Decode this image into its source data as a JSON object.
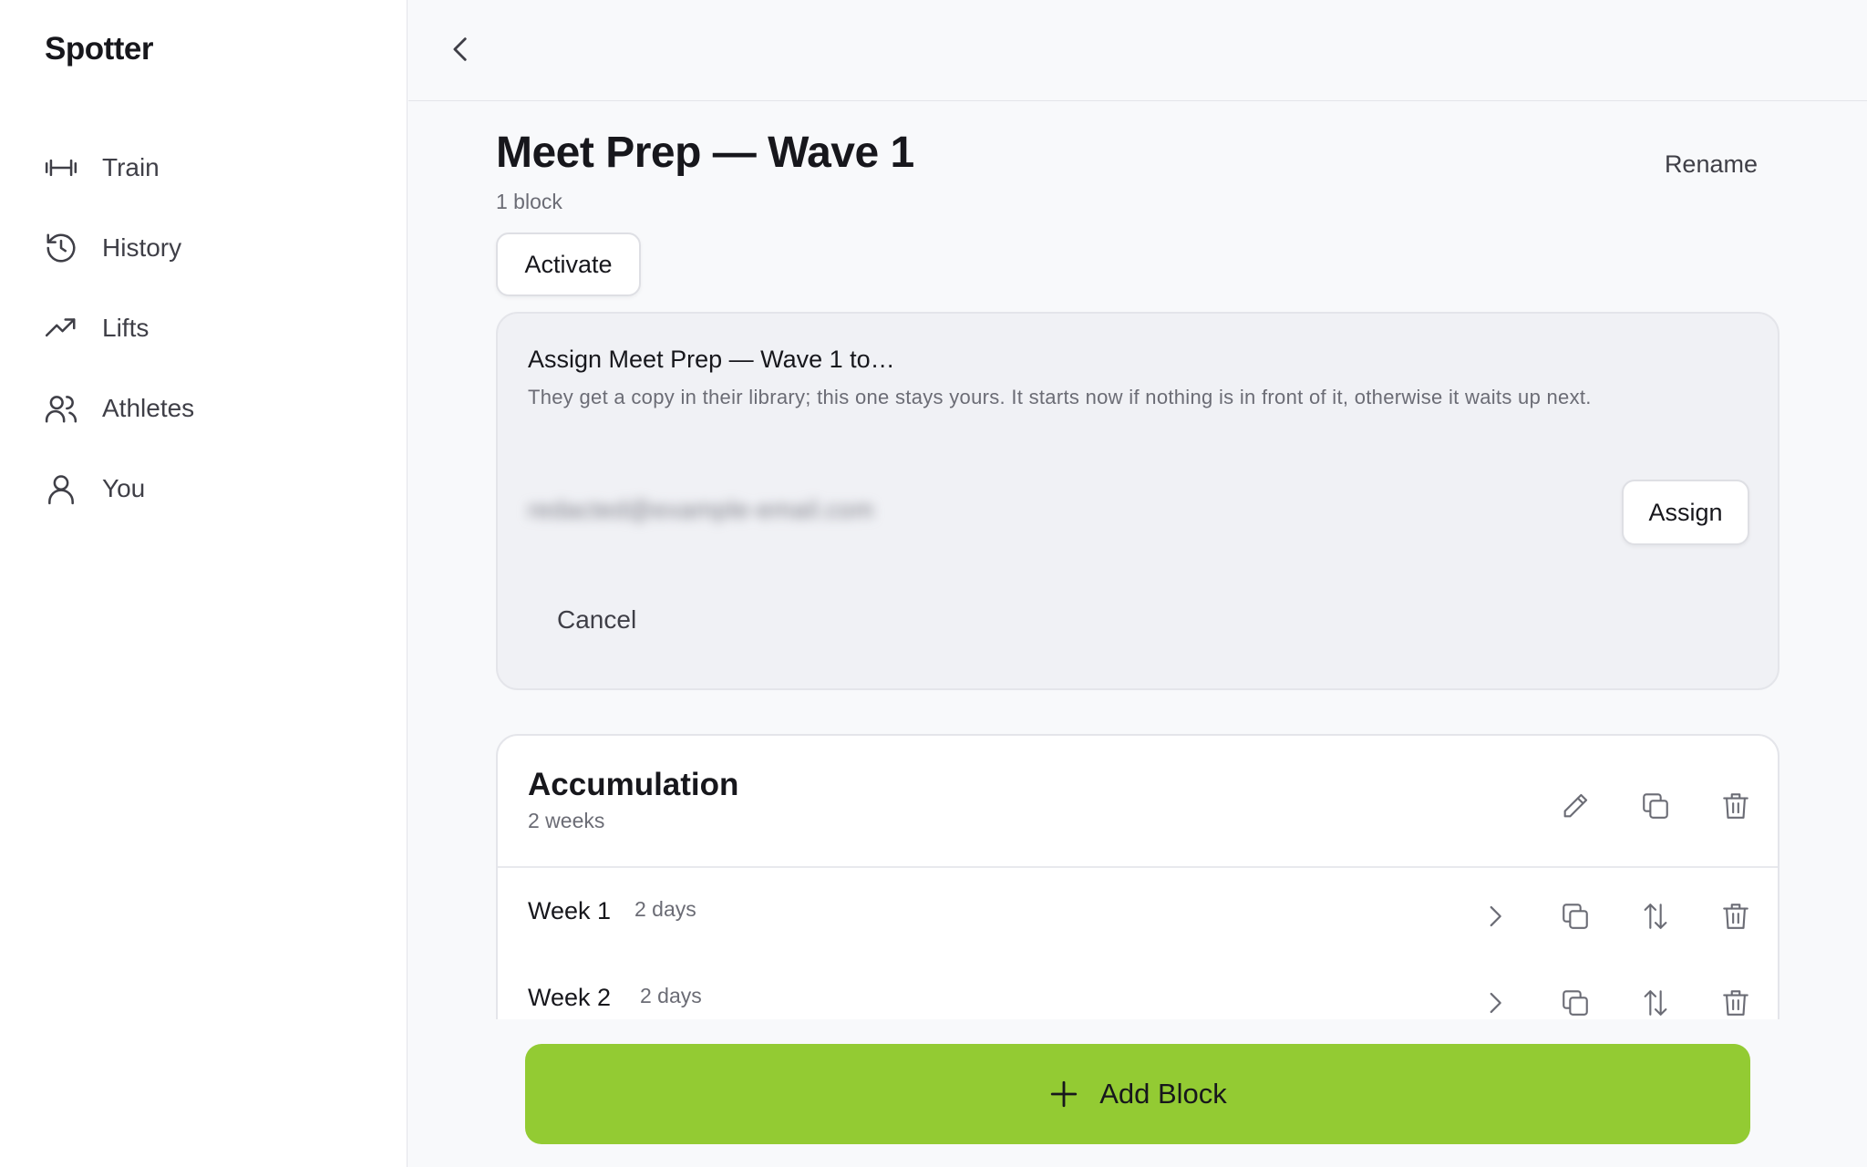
{
  "app": {
    "name": "Spotter"
  },
  "sidebar": {
    "items": [
      {
        "label": "Train",
        "icon": "dumbbell-icon"
      },
      {
        "label": "History",
        "icon": "history-icon"
      },
      {
        "label": "Lifts",
        "icon": "trending-up-icon"
      },
      {
        "label": "Athletes",
        "icon": "users-icon"
      },
      {
        "label": "You",
        "icon": "user-icon"
      }
    ]
  },
  "program": {
    "title": "Meet Prep — Wave 1",
    "subtitle": "1 block",
    "rename_label": "Rename",
    "activate_label": "Activate"
  },
  "assign": {
    "title": "Assign Meet Prep — Wave 1 to…",
    "description": "They get a copy in their library; this one stays yours. It starts now if nothing is in front of it, otherwise it waits up next.",
    "email_value": "redacted@example-email.com",
    "assign_label": "Assign",
    "cancel_label": "Cancel"
  },
  "block": {
    "name": "Accumulation",
    "weeks_label": "2 weeks",
    "weeks": [
      {
        "name": "Week 1",
        "days": "2 days"
      },
      {
        "name": "Week 2",
        "days": "2 days"
      }
    ]
  },
  "footer": {
    "add_block_label": "Add Block",
    "accent": "#93cb33"
  }
}
